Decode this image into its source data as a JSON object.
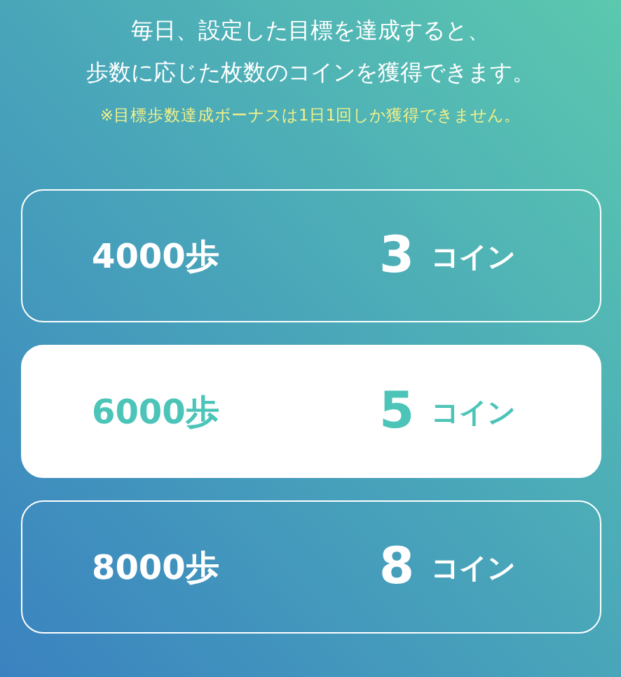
{
  "intro": [
    "毎日、設定した目標を達成すると、",
    "歩数に応じた枚数のコインを獲得できます。"
  ],
  "note": "※目標歩数達成ボーナスは1日1回しか獲得できません。",
  "options": [
    {
      "steps": "4000歩",
      "coins": "3",
      "unit": "コイン",
      "selected": false
    },
    {
      "steps": "6000歩",
      "coins": "5",
      "unit": "コイン",
      "selected": true
    },
    {
      "steps": "8000歩",
      "coins": "8",
      "unit": "コイン",
      "selected": false
    }
  ]
}
